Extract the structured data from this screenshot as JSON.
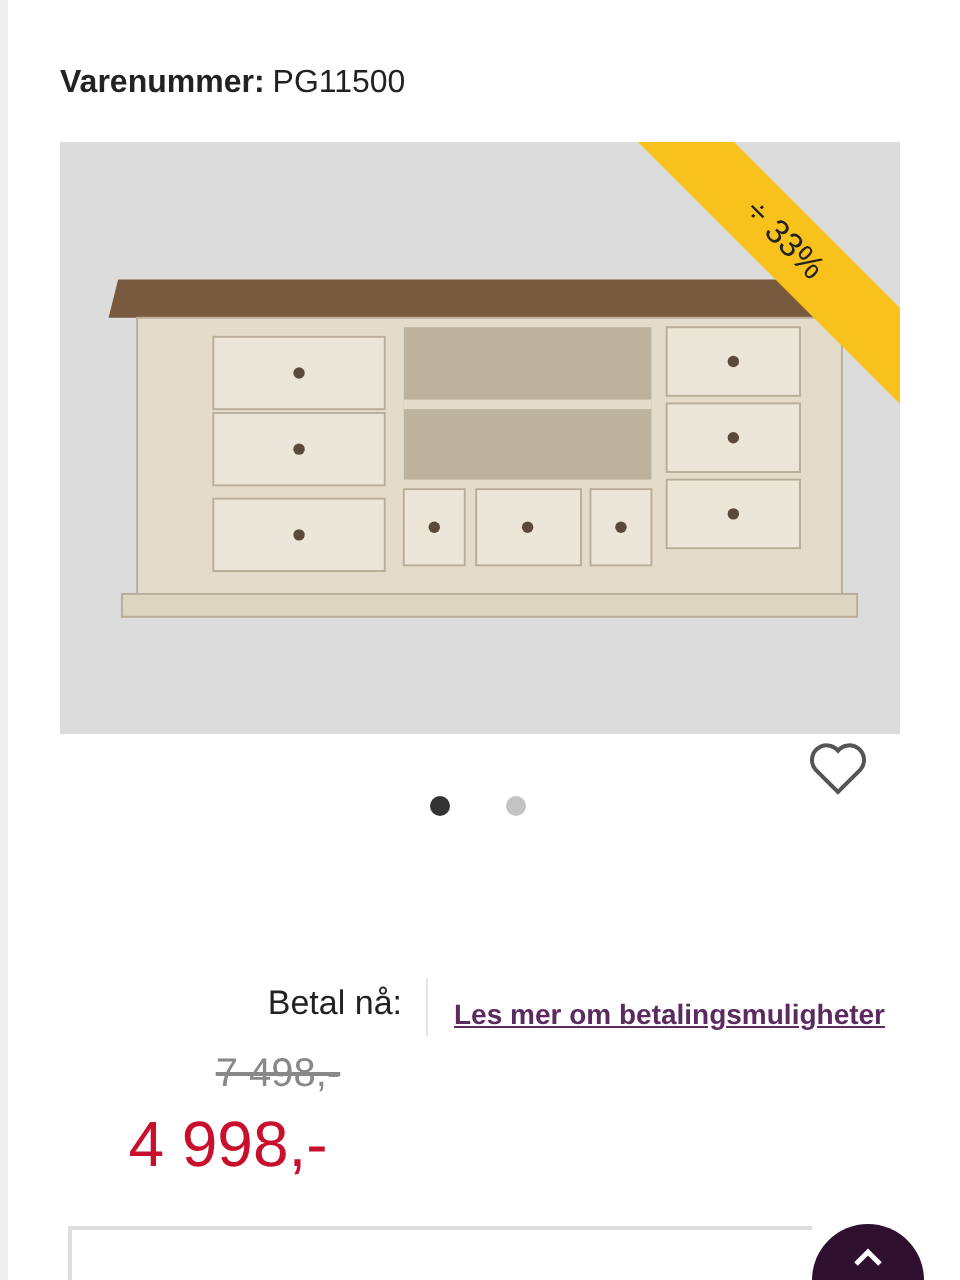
{
  "product": {
    "sku_label": "Varenummer:",
    "sku": "PG11500"
  },
  "gallery": {
    "discount": "÷ 33%",
    "favorite": false,
    "dots": [
      {
        "selected": true
      },
      {
        "selected": false
      }
    ]
  },
  "price": {
    "pay_now_label": "Betal nå:",
    "payment_link": "Les mer om betalingsmuligheter",
    "old_price": "7 498,-",
    "price": "4 998,-"
  }
}
